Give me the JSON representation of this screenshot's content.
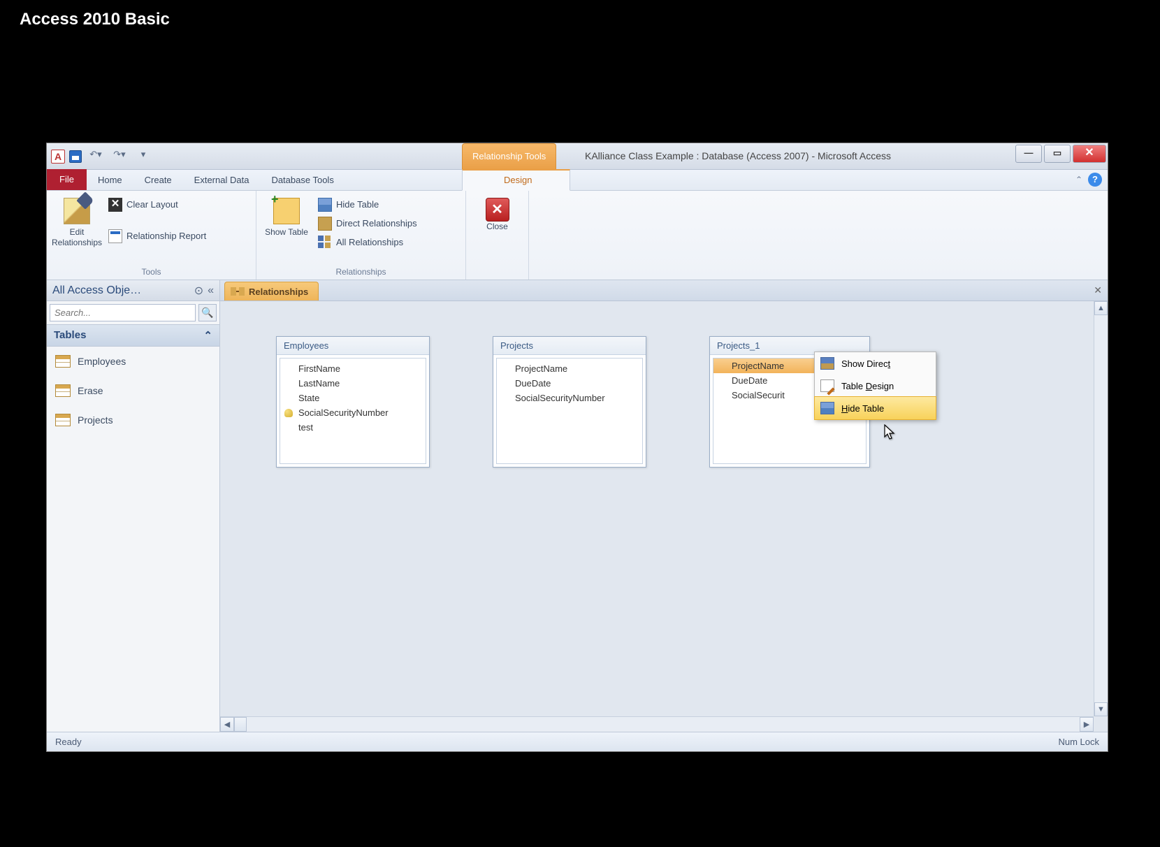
{
  "video_title": "Access 2010 Basic",
  "titlebar": {
    "contextual_tab": "Relationship Tools",
    "window_title": "KAlliance Class Example : Database (Access 2007) - Microsoft Access"
  },
  "ribbon_tabs": {
    "file": "File",
    "home": "Home",
    "create": "Create",
    "external_data": "External Data",
    "database_tools": "Database Tools",
    "design": "Design"
  },
  "ribbon": {
    "tools": {
      "edit_relationships": "Edit Relationships",
      "clear_layout": "Clear Layout",
      "relationship_report": "Relationship Report",
      "label": "Tools"
    },
    "relationships": {
      "show_table": "Show Table",
      "hide_table": "Hide Table",
      "direct_relationships": "Direct Relationships",
      "all_relationships": "All Relationships",
      "close": "Close",
      "label": "Relationships"
    }
  },
  "nav": {
    "title": "All Access Obje…",
    "search_placeholder": "Search...",
    "group_tables": "Tables",
    "items": {
      "employees": "Employees",
      "erase": "Erase",
      "projects": "Projects"
    }
  },
  "doc_tab": "Relationships",
  "tables": {
    "employees": {
      "title": "Employees",
      "fields": {
        "0": "FirstName",
        "1": "LastName",
        "2": "State",
        "3": "SocialSecurityNumber",
        "4": "test"
      }
    },
    "projects": {
      "title": "Projects",
      "fields": {
        "0": "ProjectName",
        "1": "DueDate",
        "2": "SocialSecurityNumber"
      }
    },
    "projects_1": {
      "title": "Projects_1",
      "fields": {
        "0": "ProjectName",
        "1": "DueDate",
        "2": "SocialSecurit"
      }
    }
  },
  "context_menu": {
    "show_direct": "Show Direct",
    "table_design": "Table Design",
    "hide_table": "Hide Table"
  },
  "status": {
    "left": "Ready",
    "right": "Num Lock"
  }
}
